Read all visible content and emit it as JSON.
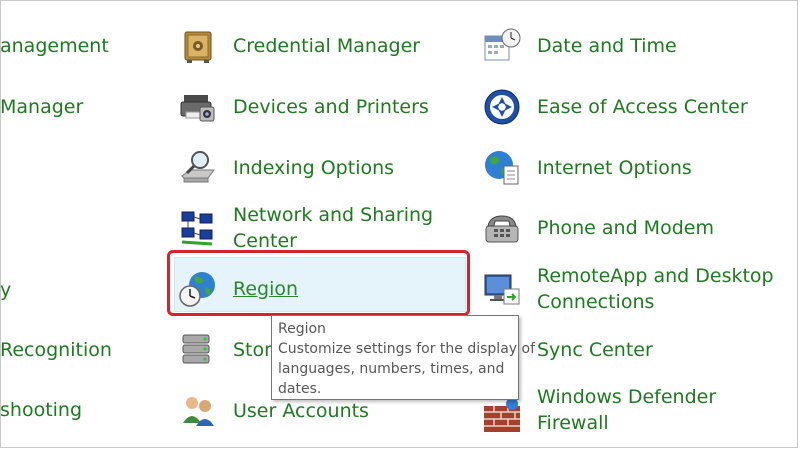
{
  "left_column": [
    {
      "label": "anagement",
      "name": "left-item-management"
    },
    {
      "label": "Manager",
      "name": "left-item-manager"
    },
    {
      "label": "y",
      "name": "left-item-y"
    },
    {
      "label": "Recognition",
      "name": "left-item-recognition"
    },
    {
      "label": "shooting",
      "name": "left-item-troubleshooting"
    }
  ],
  "middle_column": {
    "credential_manager": "Credential Manager",
    "devices_printers": "Devices and Printers",
    "indexing_options": "Indexing Options",
    "network_sharing_line1": "Network and Sharing",
    "network_sharing_line2": "Center",
    "region": "Region",
    "storage_partial": "Stora",
    "user_accounts": "User Accounts"
  },
  "right_column": {
    "date_time": "Date and Time",
    "ease_of_access": "Ease of Access Center",
    "internet_options": "Internet Options",
    "phone_modem": "Phone and Modem",
    "remoteapp_line1": "RemoteApp and Desktop",
    "remoteapp_line2": "Connections",
    "sync_center": "Sync Center",
    "defender_line1": "Windows Defender",
    "defender_line2": "Firewall"
  },
  "tooltip": {
    "title": "Region",
    "line1": "Customize settings for the display of",
    "line2": "languages, numbers, times, and",
    "line3": "dates."
  },
  "colors": {
    "link_green": "#1e7a1e",
    "highlight_bg": "#e5f3fb",
    "annotation_red": "#d8232a"
  }
}
